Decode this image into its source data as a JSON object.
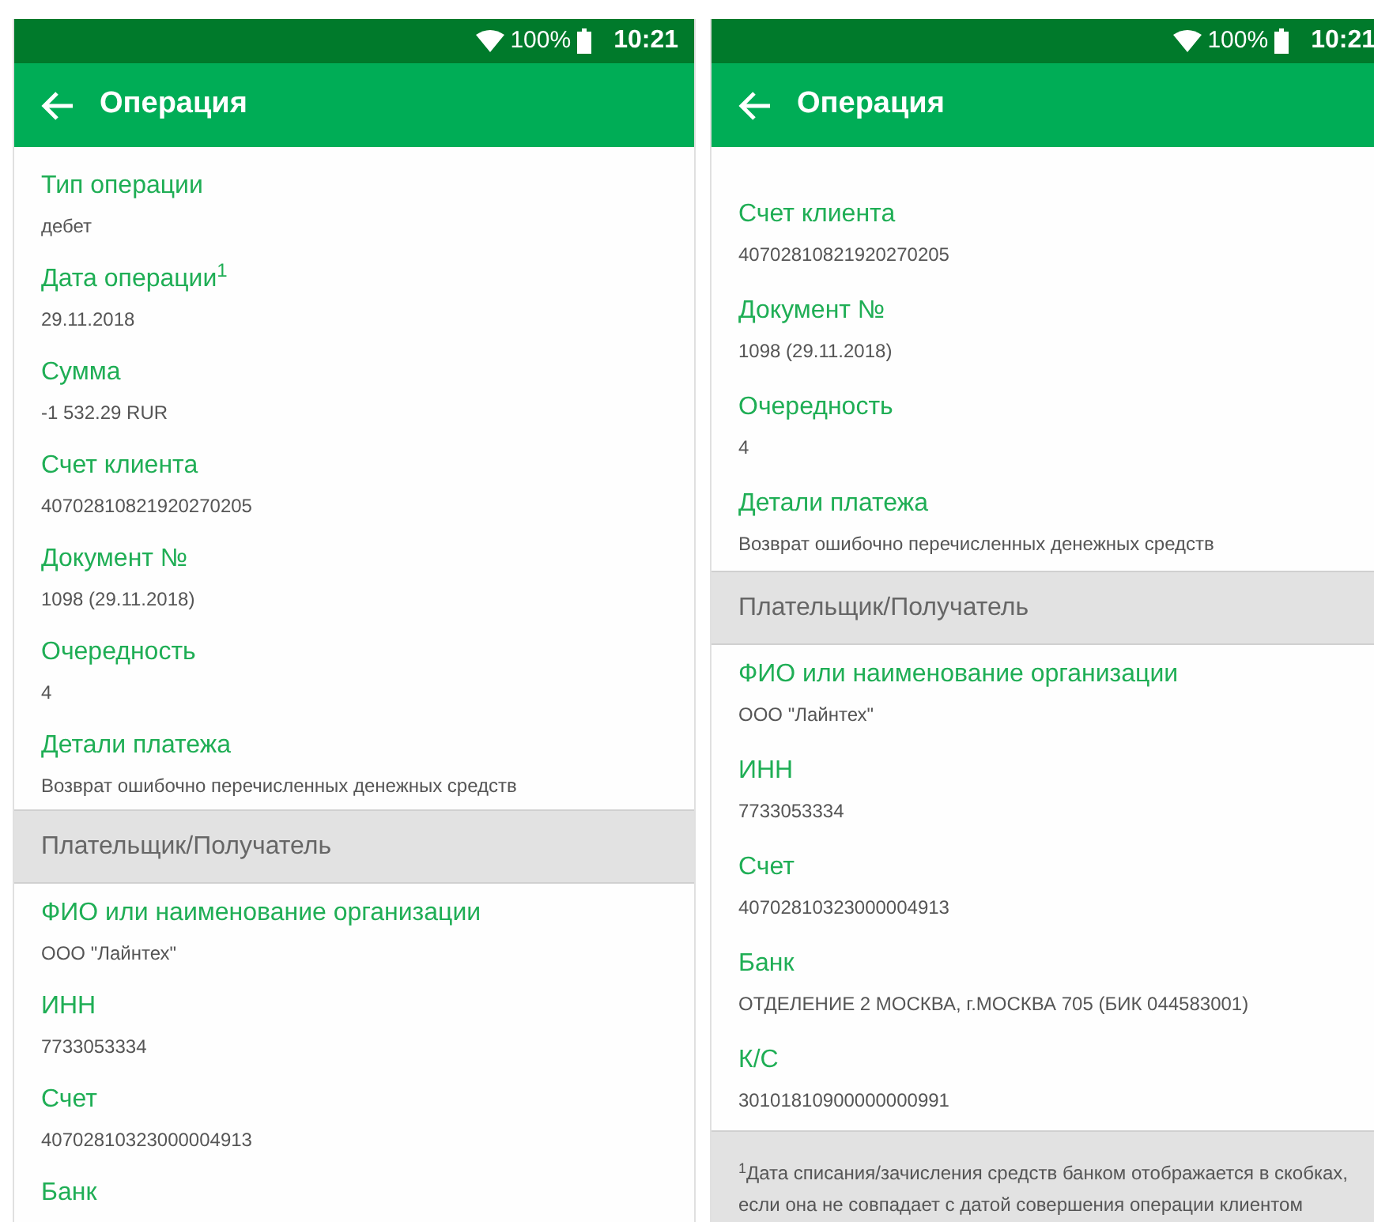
{
  "screens": [
    {
      "status_bar": {
        "battery": "100%",
        "time": "10:21"
      },
      "title": "Операция",
      "scrolled": false,
      "items": [
        {
          "kind": "field",
          "label": "Тип операции",
          "value": "дебет"
        },
        {
          "kind": "field",
          "label": "Дата операции$^{1}$",
          "value": "29.11.2018"
        },
        {
          "kind": "field",
          "label": "Сумма",
          "value": "-1 532.29 RUR"
        },
        {
          "kind": "field",
          "label": "Счет клиента",
          "value": "40702810821920270205"
        },
        {
          "kind": "field",
          "label": "Документ №",
          "value": "1098 (29.11.2018)"
        },
        {
          "kind": "field",
          "label": "Очередность",
          "value": "4"
        },
        {
          "kind": "field",
          "label": "Детали платежа",
          "value": "Возврат ошибочно перечисленных денежных средств"
        },
        {
          "kind": "section",
          "label": "Плательщик/Получатель"
        },
        {
          "kind": "field",
          "label": "ФИО или наименование организации",
          "value": "ООО \"Лайнтех\""
        },
        {
          "kind": "field",
          "label": "ИНН",
          "value": "7733053334"
        },
        {
          "kind": "field",
          "label": "Счет",
          "value": "40702810323000004913"
        },
        {
          "kind": "field",
          "label": "Банк"
        }
      ]
    },
    {
      "status_bar": {
        "battery": "100%",
        "time": "10:21"
      },
      "title": "Операция",
      "scrolled": true,
      "items": [
        {
          "kind": "field",
          "label": "Счет клиента",
          "value": "40702810821920270205"
        },
        {
          "kind": "field",
          "label": "Документ №",
          "value": "1098 (29.11.2018)"
        },
        {
          "kind": "field",
          "label": "Очередность",
          "value": "4"
        },
        {
          "kind": "field",
          "label": "Детали платежа",
          "value": "Возврат ошибочно перечисленных денежных средств"
        },
        {
          "kind": "section",
          "label": "Плательщик/Получатель"
        },
        {
          "kind": "field",
          "label": "ФИО или наименование организации",
          "value": "ООО \"Лайнтех\""
        },
        {
          "kind": "field",
          "label": "ИНН",
          "value": "7733053334"
        },
        {
          "kind": "field",
          "label": "Счет",
          "value": "40702810323000004913"
        },
        {
          "kind": "field",
          "label": "Банк",
          "value": "ОТДЕЛЕНИЕ 2 МОСКВА, г.МОСКВА 705 (БИК 044583001)"
        },
        {
          "kind": "field",
          "label": "К/С",
          "value": "30101810900000000991"
        },
        {
          "kind": "footnote",
          "label": "$^{1}$Дата списания/зачисления средств банком отображается в скобках, если она не совпадает с датой совершения операции клиентом"
        }
      ]
    }
  ]
}
